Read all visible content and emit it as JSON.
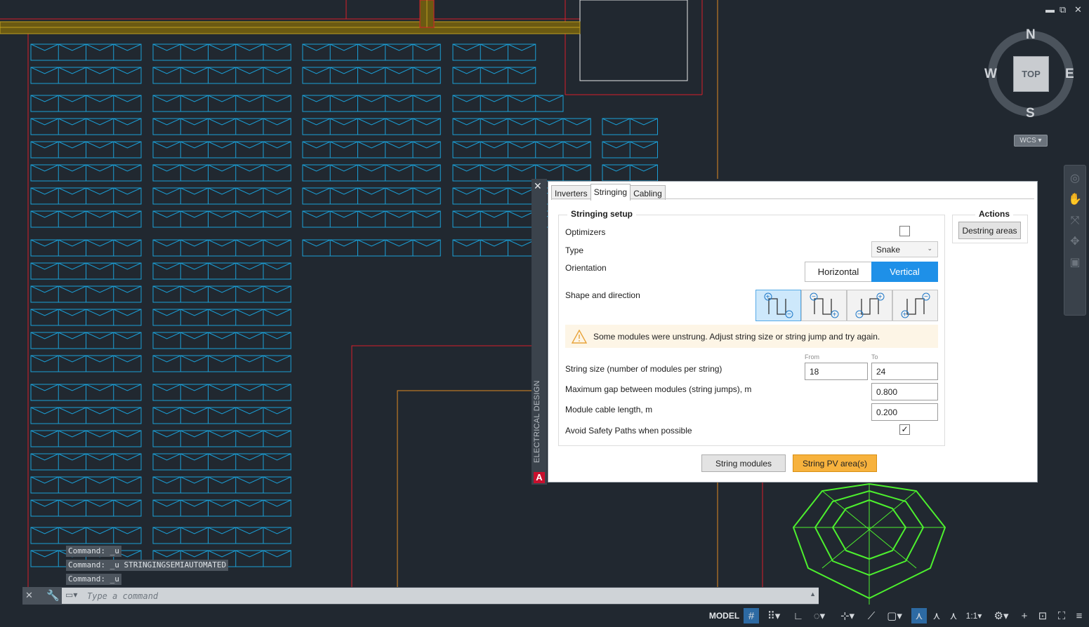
{
  "window_controls": {
    "minimize": "▬",
    "restore": "⧉",
    "close": "✕"
  },
  "viewcube": {
    "north": "N",
    "south": "S",
    "east": "E",
    "west": "W",
    "top": "TOP",
    "wcs": "WCS ▾"
  },
  "palette": {
    "vertical_title": "ELECTRICAL DESIGN",
    "close_label": "✕",
    "logo_letter": "A",
    "tabs": [
      "Inverters",
      "Stringing",
      "Cabling"
    ],
    "active_tab": "Stringing"
  },
  "stringing_setup": {
    "title": "Stringing setup",
    "optimizers_label": "Optimizers",
    "optimizers_checked": false,
    "type_label": "Type",
    "type_value": "Snake",
    "orientation_label": "Orientation",
    "orientation_options": [
      "Horizontal",
      "Vertical"
    ],
    "orientation_selected": "Vertical",
    "shape_label": "Shape and direction",
    "shape_options": [
      {
        "icon": "snake-start-top-left-icon",
        "selected": true
      },
      {
        "icon": "snake-start-top-left-end-right-icon",
        "selected": false
      },
      {
        "icon": "snake-start-top-right-icon",
        "selected": false
      },
      {
        "icon": "snake-start-top-right-end-left-icon",
        "selected": false
      }
    ],
    "warning": "Some modules were unstrung. Adjust string size or string jump and try again.",
    "string_size_label": "String size (number of modules per string)",
    "from_label": "From",
    "to_label": "To",
    "string_size_from": "18",
    "string_size_to": "24",
    "gap_label": "Maximum gap between modules (string jumps), m",
    "gap_value": "0.800",
    "cable_label": "Module cable length, m",
    "cable_value": "0.200",
    "avoid_label": "Avoid Safety Paths when possible",
    "avoid_checked": true
  },
  "actions": {
    "title": "Actions",
    "destring_label": "Destring areas"
  },
  "footer": {
    "string_modules_label": "String modules",
    "string_pv_label": "String PV area(s)"
  },
  "command_history": [
    "Command: _u",
    "Command: _u STRINGINGSEMIAUTOMATED",
    "Command: _u"
  ],
  "command_placeholder": "Type a command",
  "status": {
    "model_label": "MODEL",
    "scale_label": "1:1"
  },
  "colors": {
    "module": "#1b9fd6",
    "boundary_red": "#d81e2a",
    "boundary_orange": "#e08a22",
    "accent_blue": "#1e90e8",
    "action_orange": "#f7b23d",
    "green_symbol": "#4df02e"
  }
}
